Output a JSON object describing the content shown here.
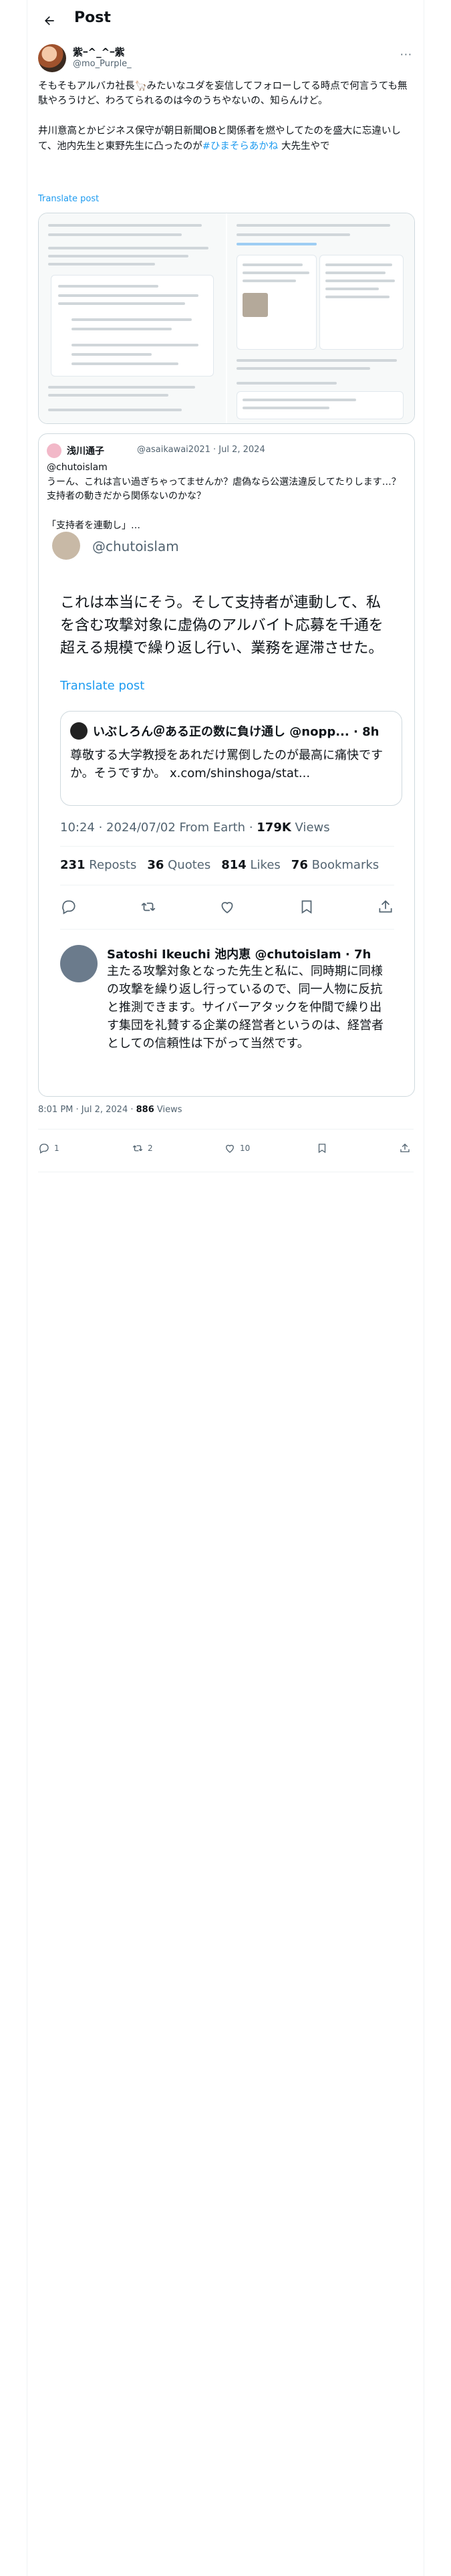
{
  "header": {
    "title": "Post"
  },
  "author": {
    "display_name": "紫ｰ^_^ｰ紫",
    "handle": "@mo_Purple_"
  },
  "post": {
    "text_main": "そもそもアルバカ社長🦙みたいなユダを妄信してフォローしてる時点で何言うても無駄やろうけど、わろてられるのは今のうちやないの、知らんけど。\n\n井川意高とかビジネス保守が朝日新聞OBと関係者を燃やしてたのを盛大に忘違いして、池内先生と東野先生に凸ったのが",
    "hashtag": "#ひまそらあかね",
    "text_tail": " 大先生やで",
    "translate_label": "Translate post"
  },
  "quote": {
    "name": "浅川通子",
    "handle": "@asaikawai2021 · Jul 2, 2024",
    "text": "@chutoislam\nうーん、これは言い過ぎちゃってませんか？虐偽なら公選法違反してたりします…？支持者の動きだから関係ないのかな？\n\n「支持者を連動し」…"
  },
  "embedded": {
    "handle": "@chutoislam",
    "text": "これは本当にそう。そして支持者が連動して、私を含む攻撃対象に虚偽のアルバイト応募を千通を超える規模で繰り返し行い、業務を遅滞させた。",
    "translate_label": "Translate post",
    "quoted_name": "いぶしろん＠ある正の数に負け通し @nopp... · 8h",
    "quoted_text": "尊敬する大学教授をあれだけ罵倒したのが最高に痛快ですか。そうですか。 x.com/shinshoga/stat...",
    "meta_time": "10:24 · 2024/07/02 From Earth · ",
    "views": "179K",
    "views_label": " Views",
    "stats": [
      {
        "num": "231",
        "label": " Reposts"
      },
      {
        "num": "36",
        "label": " Quotes"
      },
      {
        "num": "814",
        "label": " Likes"
      },
      {
        "num": "76",
        "label": " Bookmarks"
      }
    ],
    "reply_name": "Satoshi Ikeuchi 池内恵 @chutoislam · 7h",
    "reply_text": "主たる攻撃対象となった先生と私に、同時期に同様の攻撃を繰り返し行っているので、同一人物に反抗と推測できます。サイバーアタックを仲間で繰り出す集団を礼賛する企業の経営者というのは、経営者としての信頼性は下がって当然です。"
  },
  "meta": {
    "time": "8:01 PM · Jul 2, 2024 · ",
    "views": "886",
    "views_label": " Views"
  },
  "actions": {
    "replies": "1",
    "reposts": "2",
    "likes": "10"
  }
}
